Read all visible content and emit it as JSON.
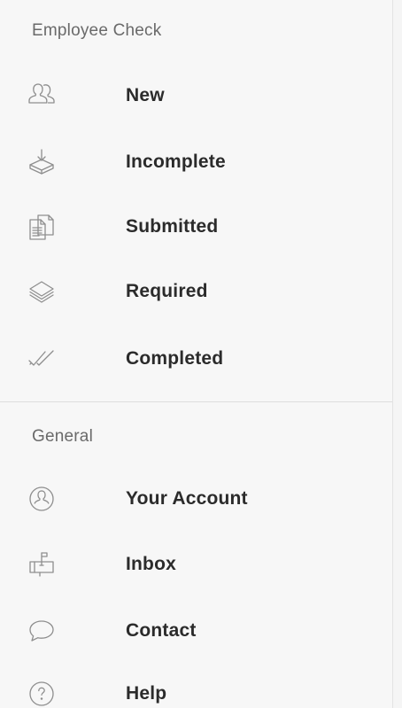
{
  "sections": [
    {
      "header": "Employee Check",
      "items": [
        {
          "label": "New",
          "icon": "users-icon"
        },
        {
          "label": "Incomplete",
          "icon": "tray-download-icon"
        },
        {
          "label": "Submitted",
          "icon": "documents-icon"
        },
        {
          "label": "Required",
          "icon": "layers-icon"
        },
        {
          "label": "Completed",
          "icon": "double-check-icon"
        }
      ]
    },
    {
      "header": "General",
      "items": [
        {
          "label": "Your Account",
          "icon": "account-circle-icon"
        },
        {
          "label": "Inbox",
          "icon": "mailbox-icon"
        },
        {
          "label": "Contact",
          "icon": "speech-bubble-icon"
        },
        {
          "label": "Help",
          "icon": "help-circle-icon"
        }
      ]
    }
  ],
  "colors": {
    "background": "#f7f7f7",
    "header_text": "#6a6a6a",
    "label_text": "#2b2b2b",
    "icon_stroke": "#8e8e8e",
    "divider": "#dedede"
  }
}
